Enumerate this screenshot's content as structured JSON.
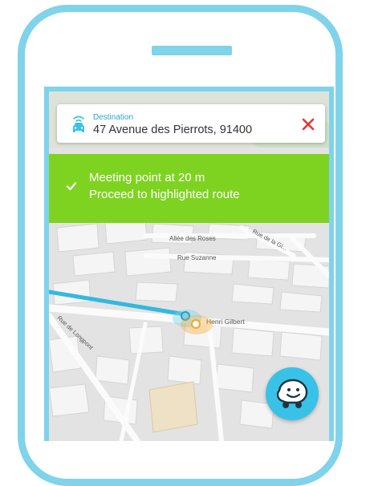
{
  "destination": {
    "label": "Destination",
    "address": "47 Avenue des Pierrots, 91400"
  },
  "banner": {
    "line1": "Meeting point at 20 m",
    "line2": "Proceed to highlighted route"
  },
  "map": {
    "streets": {
      "allee_des_roses": "Allée des Roses",
      "rue_suzanne": "Rue Suzanne",
      "rue_de_la_gi": "Rue de la Gi...",
      "rue_de_longpont": "Rue de Longpont",
      "henri_gilbert": "Henri Gilbert"
    }
  },
  "icons": {
    "car": "car-wifi-icon",
    "close": "close-icon",
    "check": "checkmark-icon",
    "waze": "waze-logo-icon"
  },
  "colors": {
    "accent": "#7fd3ea",
    "banner": "#7ed321",
    "close": "#e53935",
    "route": "#33b8e0",
    "waze": "#38c2e8",
    "destination_label": "#2ba5cf"
  }
}
